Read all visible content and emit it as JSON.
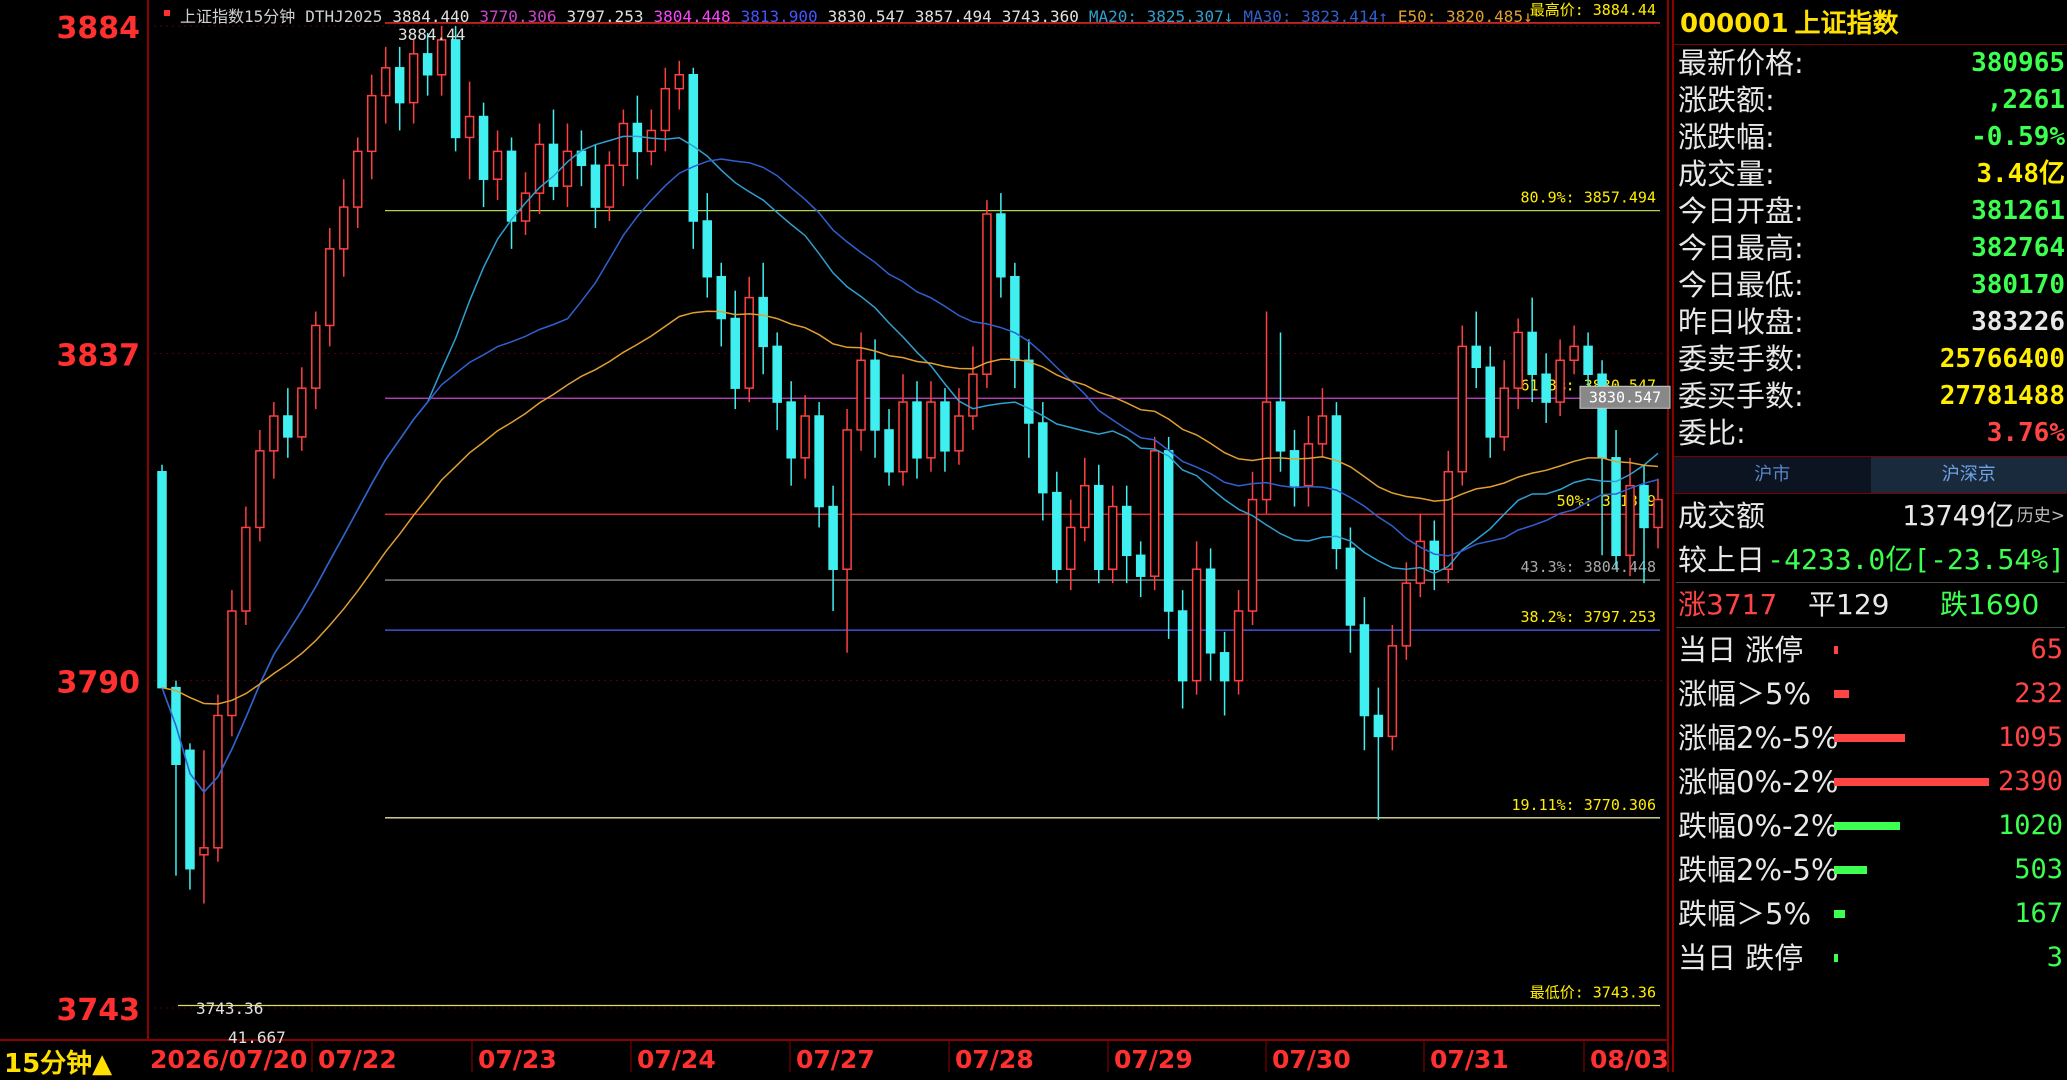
{
  "legend": {
    "index_name": "上证指数15分钟",
    "indicator": "DTHJ2025",
    "values": [
      {
        "text": "3884.440",
        "color": "#e0e0e0"
      },
      {
        "text": "3770.306",
        "color": "#cc44cc"
      },
      {
        "text": "3797.253",
        "color": "#e0e0e0"
      },
      {
        "text": "3804.448",
        "color": "#ff44ff"
      },
      {
        "text": "3813.900",
        "color": "#4455ff"
      },
      {
        "text": "3830.547",
        "color": "#e0e0e0"
      },
      {
        "text": "3857.494",
        "color": "#e0e0e0"
      },
      {
        "text": "3743.360",
        "color": "#e0e0e0"
      },
      {
        "text": "MA20: 3825.307↓",
        "color": "#2fa0d0"
      },
      {
        "text": "MA30: 3823.414↑",
        "color": "#3060d0"
      },
      {
        "text": "E50: 3820.485↓",
        "color": "#e0a030"
      }
    ]
  },
  "chart_data": {
    "type": "candlestick",
    "y_axis_labels": [
      "3884",
      "3837",
      "3790",
      "3743"
    ],
    "ylim": [
      3743,
      3884
    ],
    "date_labels": [
      "2026/07/20",
      "07/22",
      "07/23",
      "07/24",
      "07/27",
      "07/28",
      "07/29",
      "07/30",
      "07/31",
      "08/03"
    ],
    "timeframe_label": "15分钟▲",
    "high_marker": "3884.44",
    "low_marker": "3743.36",
    "volume_marker": "41.667",
    "fib_levels": [
      {
        "label": "最高价: 3884.44",
        "value": 3884.44,
        "color": "#ff3030",
        "label_color": "#ffee00"
      },
      {
        "label": "80.9%: 3857.494",
        "value": 3857.494,
        "color": "#b0d050",
        "label_color": "#ffee00"
      },
      {
        "label": "61.8%: 3830.547",
        "value": 3830.547,
        "color": "#cc44cc",
        "label_color": "#ffee00"
      },
      {
        "label": "50%: 3813.9",
        "value": 3813.9,
        "color": "#ff3030",
        "label_color": "#ffee00"
      },
      {
        "label": "43.3%: 3804.448",
        "value": 3804.448,
        "color": "#888888",
        "label_color": "#aaaaaa"
      },
      {
        "label": "38.2%: 3797.253",
        "value": 3797.253,
        "color": "#5060ff",
        "label_color": "#ffee00"
      },
      {
        "label": "最低价: 3743.36",
        "value": 3743.36,
        "color": "#e0e060",
        "label_color": "#ffee00"
      },
      {
        "label": "19.11%: 3770.306",
        "value": 3770.306,
        "color": "#e0e0a0",
        "label_color": "#ffee00"
      }
    ],
    "current_price_tag": "3830.547",
    "series": [
      {
        "name": "MA20",
        "color": "#2fa0d0"
      },
      {
        "name": "MA30",
        "color": "#3060d0"
      },
      {
        "name": "E50",
        "color": "#e0a030"
      }
    ],
    "candles": [
      [
        3820,
        3789,
        3821,
        3789
      ],
      [
        3789,
        3778,
        3790,
        3762
      ],
      [
        3780,
        3763,
        3781,
        3760
      ],
      [
        3765,
        3766,
        3780,
        3758
      ],
      [
        3766,
        3785,
        3788,
        3764
      ],
      [
        3785,
        3800,
        3803,
        3782
      ],
      [
        3800,
        3812,
        3815,
        3798
      ],
      [
        3812,
        3823,
        3826,
        3810
      ],
      [
        3823,
        3828,
        3830,
        3819
      ],
      [
        3828,
        3825,
        3832,
        3822
      ],
      [
        3825,
        3832,
        3835,
        3823
      ],
      [
        3832,
        3841,
        3843,
        3829
      ],
      [
        3841,
        3852,
        3855,
        3838
      ],
      [
        3852,
        3858,
        3862,
        3848
      ],
      [
        3858,
        3866,
        3868,
        3855
      ],
      [
        3866,
        3874,
        3877,
        3862
      ],
      [
        3874,
        3878,
        3881,
        3870
      ],
      [
        3878,
        3873,
        3881,
        3869
      ],
      [
        3873,
        3880,
        3882,
        3870
      ],
      [
        3880,
        3877,
        3883,
        3874
      ],
      [
        3877,
        3882,
        3884,
        3874
      ],
      [
        3882,
        3868,
        3884,
        3866
      ],
      [
        3868,
        3871,
        3876,
        3862
      ],
      [
        3871,
        3862,
        3873,
        3858
      ],
      [
        3862,
        3866,
        3869,
        3859
      ],
      [
        3866,
        3856,
        3868,
        3852
      ],
      [
        3856,
        3860,
        3863,
        3854
      ],
      [
        3860,
        3867,
        3870,
        3857
      ],
      [
        3867,
        3861,
        3872,
        3859
      ],
      [
        3861,
        3866,
        3870,
        3858
      ],
      [
        3866,
        3864,
        3869,
        3861
      ],
      [
        3864,
        3858,
        3867,
        3855
      ],
      [
        3858,
        3864,
        3866,
        3856
      ],
      [
        3864,
        3870,
        3872,
        3861
      ],
      [
        3870,
        3866,
        3874,
        3862
      ],
      [
        3866,
        3869,
        3872,
        3864
      ],
      [
        3869,
        3875,
        3878,
        3866
      ],
      [
        3875,
        3877,
        3879,
        3872
      ],
      [
        3877,
        3856,
        3878,
        3852
      ],
      [
        3856,
        3848,
        3860,
        3845
      ],
      [
        3848,
        3842,
        3850,
        3838
      ],
      [
        3842,
        3832,
        3846,
        3829
      ],
      [
        3832,
        3845,
        3848,
        3830
      ],
      [
        3845,
        3838,
        3850,
        3834
      ],
      [
        3838,
        3830,
        3840,
        3826
      ],
      [
        3830,
        3822,
        3833,
        3818
      ],
      [
        3822,
        3828,
        3831,
        3819
      ],
      [
        3828,
        3815,
        3830,
        3812
      ],
      [
        3815,
        3806,
        3818,
        3800
      ],
      [
        3806,
        3826,
        3829,
        3794
      ],
      [
        3826,
        3836,
        3840,
        3823
      ],
      [
        3836,
        3826,
        3839,
        3822
      ],
      [
        3826,
        3820,
        3829,
        3818
      ],
      [
        3820,
        3830,
        3834,
        3818
      ],
      [
        3830,
        3822,
        3833,
        3819
      ],
      [
        3822,
        3830,
        3833,
        3820
      ],
      [
        3830,
        3823,
        3832,
        3820
      ],
      [
        3823,
        3828,
        3832,
        3821
      ],
      [
        3828,
        3834,
        3838,
        3826
      ],
      [
        3834,
        3857,
        3859,
        3832
      ],
      [
        3857,
        3848,
        3860,
        3845
      ],
      [
        3848,
        3836,
        3850,
        3832
      ],
      [
        3836,
        3827,
        3839,
        3822
      ],
      [
        3827,
        3817,
        3830,
        3813
      ],
      [
        3817,
        3806,
        3820,
        3804
      ],
      [
        3806,
        3812,
        3816,
        3803
      ],
      [
        3812,
        3818,
        3822,
        3810
      ],
      [
        3818,
        3806,
        3821,
        3804
      ],
      [
        3806,
        3815,
        3818,
        3804
      ],
      [
        3815,
        3808,
        3818,
        3804
      ],
      [
        3808,
        3805,
        3810,
        3802
      ],
      [
        3805,
        3823,
        3825,
        3803
      ],
      [
        3823,
        3800,
        3825,
        3796
      ],
      [
        3800,
        3790,
        3803,
        3786
      ],
      [
        3790,
        3806,
        3810,
        3788
      ],
      [
        3806,
        3794,
        3809,
        3790
      ],
      [
        3794,
        3790,
        3797,
        3785
      ],
      [
        3790,
        3800,
        3803,
        3788
      ],
      [
        3800,
        3816,
        3820,
        3798
      ],
      [
        3816,
        3830,
        3843,
        3814
      ],
      [
        3830,
        3823,
        3840,
        3820
      ],
      [
        3823,
        3818,
        3826,
        3815
      ],
      [
        3818,
        3824,
        3828,
        3815
      ],
      [
        3824,
        3828,
        3832,
        3822
      ],
      [
        3828,
        3809,
        3830,
        3806
      ],
      [
        3809,
        3798,
        3812,
        3794
      ],
      [
        3798,
        3785,
        3802,
        3780
      ],
      [
        3785,
        3782,
        3789,
        3770
      ],
      [
        3782,
        3795,
        3798,
        3780
      ],
      [
        3795,
        3804,
        3807,
        3793
      ],
      [
        3804,
        3810,
        3814,
        3802
      ],
      [
        3810,
        3806,
        3813,
        3803
      ],
      [
        3806,
        3820,
        3823,
        3804
      ],
      [
        3820,
        3838,
        3841,
        3818
      ],
      [
        3838,
        3835,
        3843,
        3832
      ],
      [
        3835,
        3825,
        3838,
        3822
      ],
      [
        3825,
        3832,
        3836,
        3823
      ],
      [
        3832,
        3840,
        3842,
        3829
      ],
      [
        3840,
        3834,
        3845,
        3830
      ],
      [
        3834,
        3830,
        3837,
        3827
      ],
      [
        3830,
        3836,
        3839,
        3828
      ],
      [
        3836,
        3838,
        3841,
        3834
      ],
      [
        3838,
        3834,
        3840,
        3830
      ],
      [
        3834,
        3822,
        3836,
        3808
      ],
      [
        3822,
        3808,
        3826,
        3806
      ],
      [
        3808,
        3818,
        3822,
        3805
      ],
      [
        3818,
        3812,
        3821,
        3804
      ],
      [
        3812,
        3816,
        3819,
        3809
      ]
    ]
  },
  "info": {
    "code": "000001",
    "name": "上证指数",
    "rows": [
      {
        "label": "最新价格:",
        "value": "380965",
        "cls": "green"
      },
      {
        "label": "涨跌额:",
        "value": ",2261",
        "cls": "green"
      },
      {
        "label": "涨跌幅:",
        "value": "-0.59%",
        "cls": "green"
      },
      {
        "label": "成交量:",
        "value": "3.48亿",
        "cls": "yellow"
      },
      {
        "label": "今日开盘:",
        "value": "381261",
        "cls": "green"
      },
      {
        "label": "今日最高:",
        "value": "382764",
        "cls": "green"
      },
      {
        "label": "今日最低:",
        "value": "380170",
        "cls": "green"
      },
      {
        "label": "昨日收盘:",
        "value": "383226",
        "cls": "white"
      },
      {
        "label": "委卖手数:",
        "value": "25766400",
        "cls": "yellow"
      },
      {
        "label": "委买手数:",
        "value": "27781488",
        "cls": "yellow"
      },
      {
        "label": "委比:",
        "value": "3.76%",
        "cls": "red"
      }
    ],
    "tab_sh": "沪市",
    "tab_all": "沪深京",
    "turnover_label": "成交额",
    "turnover_value": "13749亿",
    "history_label": "历史>",
    "compare_label": "较上日",
    "compare_value": "-4233.0亿[-23.54%]",
    "rise_label": "涨3717",
    "flat_label": "平129",
    "fall_label": "跌1690",
    "dist": [
      {
        "label": "当日 涨停",
        "value": "65",
        "count": 65,
        "color": "#ff4444"
      },
      {
        "label": "涨幅＞5%",
        "value": "232",
        "count": 232,
        "color": "#ff4444"
      },
      {
        "label": "涨幅2%-5%",
        "value": "1095",
        "count": 1095,
        "color": "#ff4444"
      },
      {
        "label": "涨幅0%-2%",
        "value": "2390",
        "count": 2390,
        "color": "#ff4444"
      },
      {
        "label": "跌幅0%-2%",
        "value": "1020",
        "count": 1020,
        "color": "#3cff50"
      },
      {
        "label": "跌幅2%-5%",
        "value": "503",
        "count": 503,
        "color": "#3cff50"
      },
      {
        "label": "跌幅＞5%",
        "value": "167",
        "count": 167,
        "color": "#3cff50"
      },
      {
        "label": "当日 跌停",
        "value": "3",
        "count": 3,
        "color": "#3cff50"
      }
    ]
  }
}
